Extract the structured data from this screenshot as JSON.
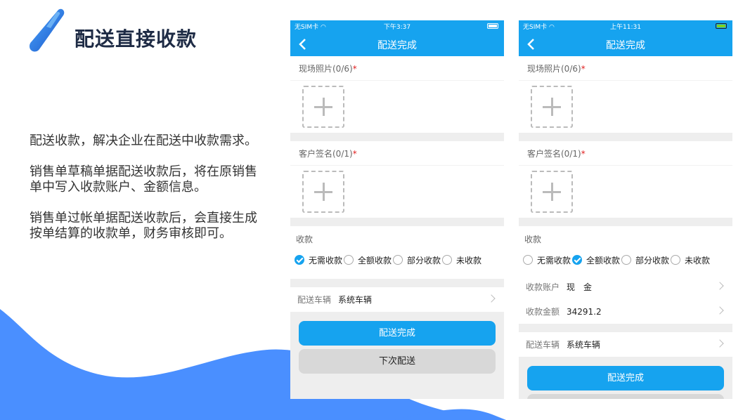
{
  "slide": {
    "title": "配送直接收款",
    "paragraphs": [
      "配送收款，解决企业在配送中收款需求。",
      "销售单草稿单据配送收款后，将在原销售单中写入收款账户、金额信息。",
      "销售单过帐单据配送收款后，会直接生成按单结算的收款单，财务审核即可。"
    ]
  },
  "colors": {
    "accent": "#16a3ef",
    "wave": "#4a8fff",
    "title": "#1e2b45",
    "required": "#e02020"
  },
  "phone1": {
    "status": {
      "carrier": "无SIM卡",
      "time": "下午3:37"
    },
    "nav_title": "配送完成",
    "photos_label": "现场照片(0/6)",
    "signature_label": "客户签名(0/1)",
    "required_mark": "*",
    "payment_label": "收款",
    "payment_options": [
      "无需收款",
      "全额收款",
      "部分收款",
      "未收款"
    ],
    "payment_selected": 0,
    "vehicle_key": "配送车辆",
    "vehicle_value": "系统车辆",
    "btn_complete": "配送完成",
    "btn_next": "下次配送"
  },
  "phone2": {
    "status": {
      "carrier": "无SIM卡",
      "time": "上午11:31"
    },
    "nav_title": "配送完成",
    "photos_label": "现场照片(0/6)",
    "signature_label": "客户签名(0/1)",
    "required_mark": "*",
    "payment_label": "收款",
    "payment_options": [
      "无需收款",
      "全额收款",
      "部分收款",
      "未收款"
    ],
    "payment_selected": 1,
    "account_key": "收款账户",
    "account_value": "现　金",
    "amount_key": "收款金额",
    "amount_value": "34291.2",
    "vehicle_key": "配送车辆",
    "vehicle_value": "系统车辆",
    "btn_complete": "配送完成"
  }
}
